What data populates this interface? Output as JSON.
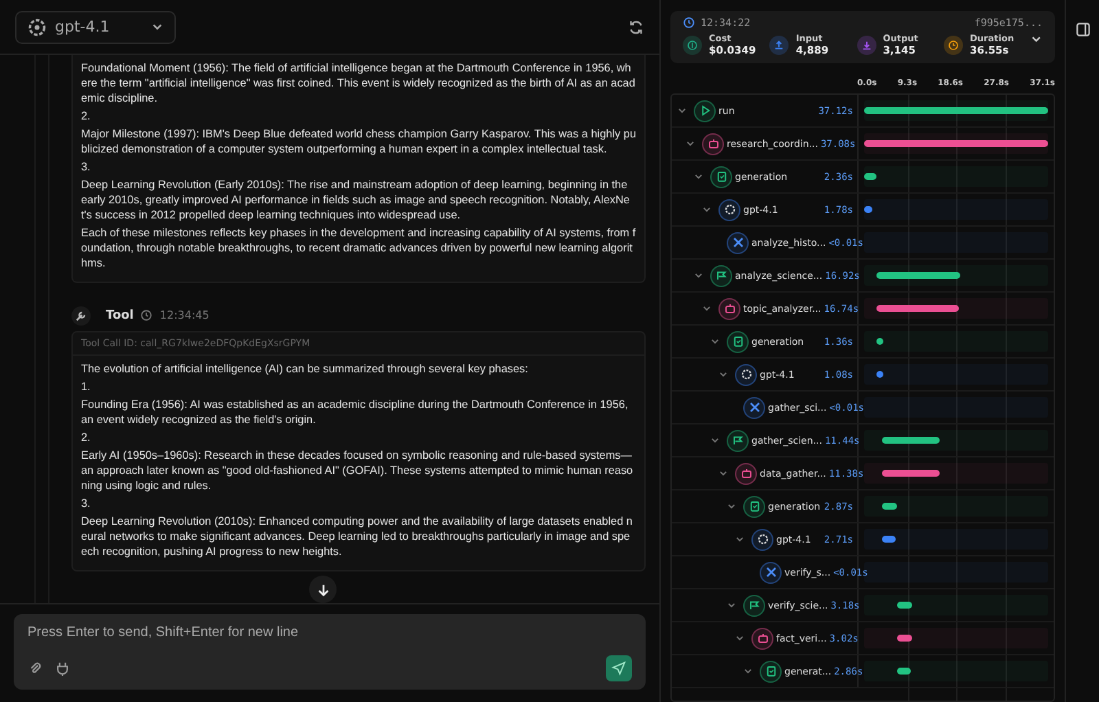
{
  "model_selector": {
    "label": "gpt-4.1"
  },
  "messages": [
    {
      "kind": "continued",
      "paragraphs": [
        "Foundational Moment (1956): The field of artificial intelligence began at the Dartmouth Conference in 1956, where the term \"artificial intelligence\" was first coined. This event is widely recognized as the birth of AI as an academic discipline.",
        "2.",
        "Major Milestone (1997): IBM's Deep Blue defeated world chess champion Garry Kasparov. This was a highly publicized demonstration of a computer system outperforming a human expert in a complex intellectual task.",
        "3.",
        "Deep Learning Revolution (Early 2010s): The rise and mainstream adoption of deep learning, beginning in the early 2010s, greatly improved AI performance in fields such as image and speech recognition. Notably, AlexNet's success in 2012 propelled deep learning techniques into widespread use.",
        "Each of these milestones reflects key phases in the development and increasing capability of AI systems, from foundation, through notable breakthroughs, to recent dramatic advances driven by powerful new learning algorithms."
      ]
    },
    {
      "kind": "tool",
      "role": "Tool",
      "time": "12:34:45",
      "call_id": "Tool Call ID: call_RG7klwe2eDFQpKdEgXsrGPYM",
      "paragraphs": [
        "The evolution of artificial intelligence (AI) can be summarized through several key phases:",
        "1.",
        "Founding Era (1956): AI was established as an academic discipline during the Dartmouth Conference in 1956, an event widely recognized as the field's origin.",
        "2.",
        "Early AI (1950s–1960s): Research in these decades focused on symbolic reasoning and rule-based systems—an approach later known as \"good old-fashioned AI\" (GOFAI). These systems attempted to mimic human reasoning using logic and rules.",
        "3.",
        "Deep Learning Revolution (2010s): Enhanced computing power and the availability of large datasets enabled neural networks to make significant advances. Deep learning led to breakthroughs particularly in image and speech recognition, pushing AI progress to new heights."
      ]
    }
  ],
  "composer": {
    "placeholder": "Press Enter to send, Shift+Enter for new line"
  },
  "trace_summary": {
    "time": "12:34:22",
    "trace_id": "f995e175...",
    "stats": [
      {
        "kind": "cost",
        "label": "Cost",
        "value": "$0.0349"
      },
      {
        "kind": "input",
        "label": "Input",
        "value": "4,889"
      },
      {
        "kind": "output",
        "label": "Output",
        "value": "3,145"
      },
      {
        "kind": "duration",
        "label": "Duration",
        "value": "36.55s"
      }
    ]
  },
  "timeline": {
    "ticks": [
      "0.0s",
      "9.3s",
      "18.6s",
      "27.8s",
      "37.1s"
    ],
    "spans": [
      {
        "kind": "chain",
        "name": "run",
        "duration": "37.12s",
        "expanded": true,
        "children": [
          {
            "kind": "agent",
            "name": "research_coordin...",
            "duration": "37.08s",
            "expanded": true,
            "children": [
              {
                "kind": "generation",
                "name": "generation",
                "duration": "2.36s",
                "expanded": true,
                "children": [
                  {
                    "kind": "llm",
                    "name": "gpt-4.1",
                    "duration": "1.78s",
                    "expanded": true,
                    "children": [
                      {
                        "kind": "tool",
                        "name": "analyze_histo...",
                        "duration": "<0.01s"
                      }
                    ]
                  }
                ]
              },
              {
                "kind": "workflow",
                "name": "analyze_science...",
                "duration": "16.92s",
                "expanded": true,
                "children": [
                  {
                    "kind": "agent",
                    "name": "topic_analyzer...",
                    "duration": "16.74s",
                    "expanded": true,
                    "children": [
                      {
                        "kind": "generation",
                        "name": "generation",
                        "duration": "1.36s",
                        "expanded": true,
                        "children": [
                          {
                            "kind": "llm",
                            "name": "gpt-4.1",
                            "duration": "1.08s",
                            "expanded": true,
                            "children": [
                              {
                                "kind": "tool",
                                "name": "gather_sci...",
                                "duration": "<0.01s"
                              }
                            ]
                          }
                        ]
                      },
                      {
                        "kind": "workflow",
                        "name": "gather_scien...",
                        "duration": "11.44s",
                        "expanded": true,
                        "children": [
                          {
                            "kind": "agent",
                            "name": "data_gather...",
                            "duration": "11.38s",
                            "expanded": true,
                            "children": [
                              {
                                "kind": "generation",
                                "name": "generation",
                                "duration": "2.87s",
                                "expanded": true,
                                "children": [
                                  {
                                    "kind": "llm",
                                    "name": "gpt-4.1",
                                    "duration": "2.71s",
                                    "expanded": true,
                                    "children": [
                                      {
                                        "kind": "tool",
                                        "name": "verify_s...",
                                        "duration": "<0.01s"
                                      }
                                    ]
                                  }
                                ]
                              },
                              {
                                "kind": "workflow",
                                "name": "verify_scie...",
                                "duration": "3.18s",
                                "expanded": true,
                                "children": [
                                  {
                                    "kind": "agent",
                                    "name": "fact_veri...",
                                    "duration": "3.02s",
                                    "expanded": true,
                                    "children": [
                                      {
                                        "kind": "generation",
                                        "name": "generat...",
                                        "duration": "2.86s",
                                        "expanded": true
                                      }
                                    ]
                                  }
                                ]
                              }
                            ]
                          }
                        ]
                      }
                    ]
                  }
                ]
              }
            ]
          }
        ]
      }
    ]
  }
}
